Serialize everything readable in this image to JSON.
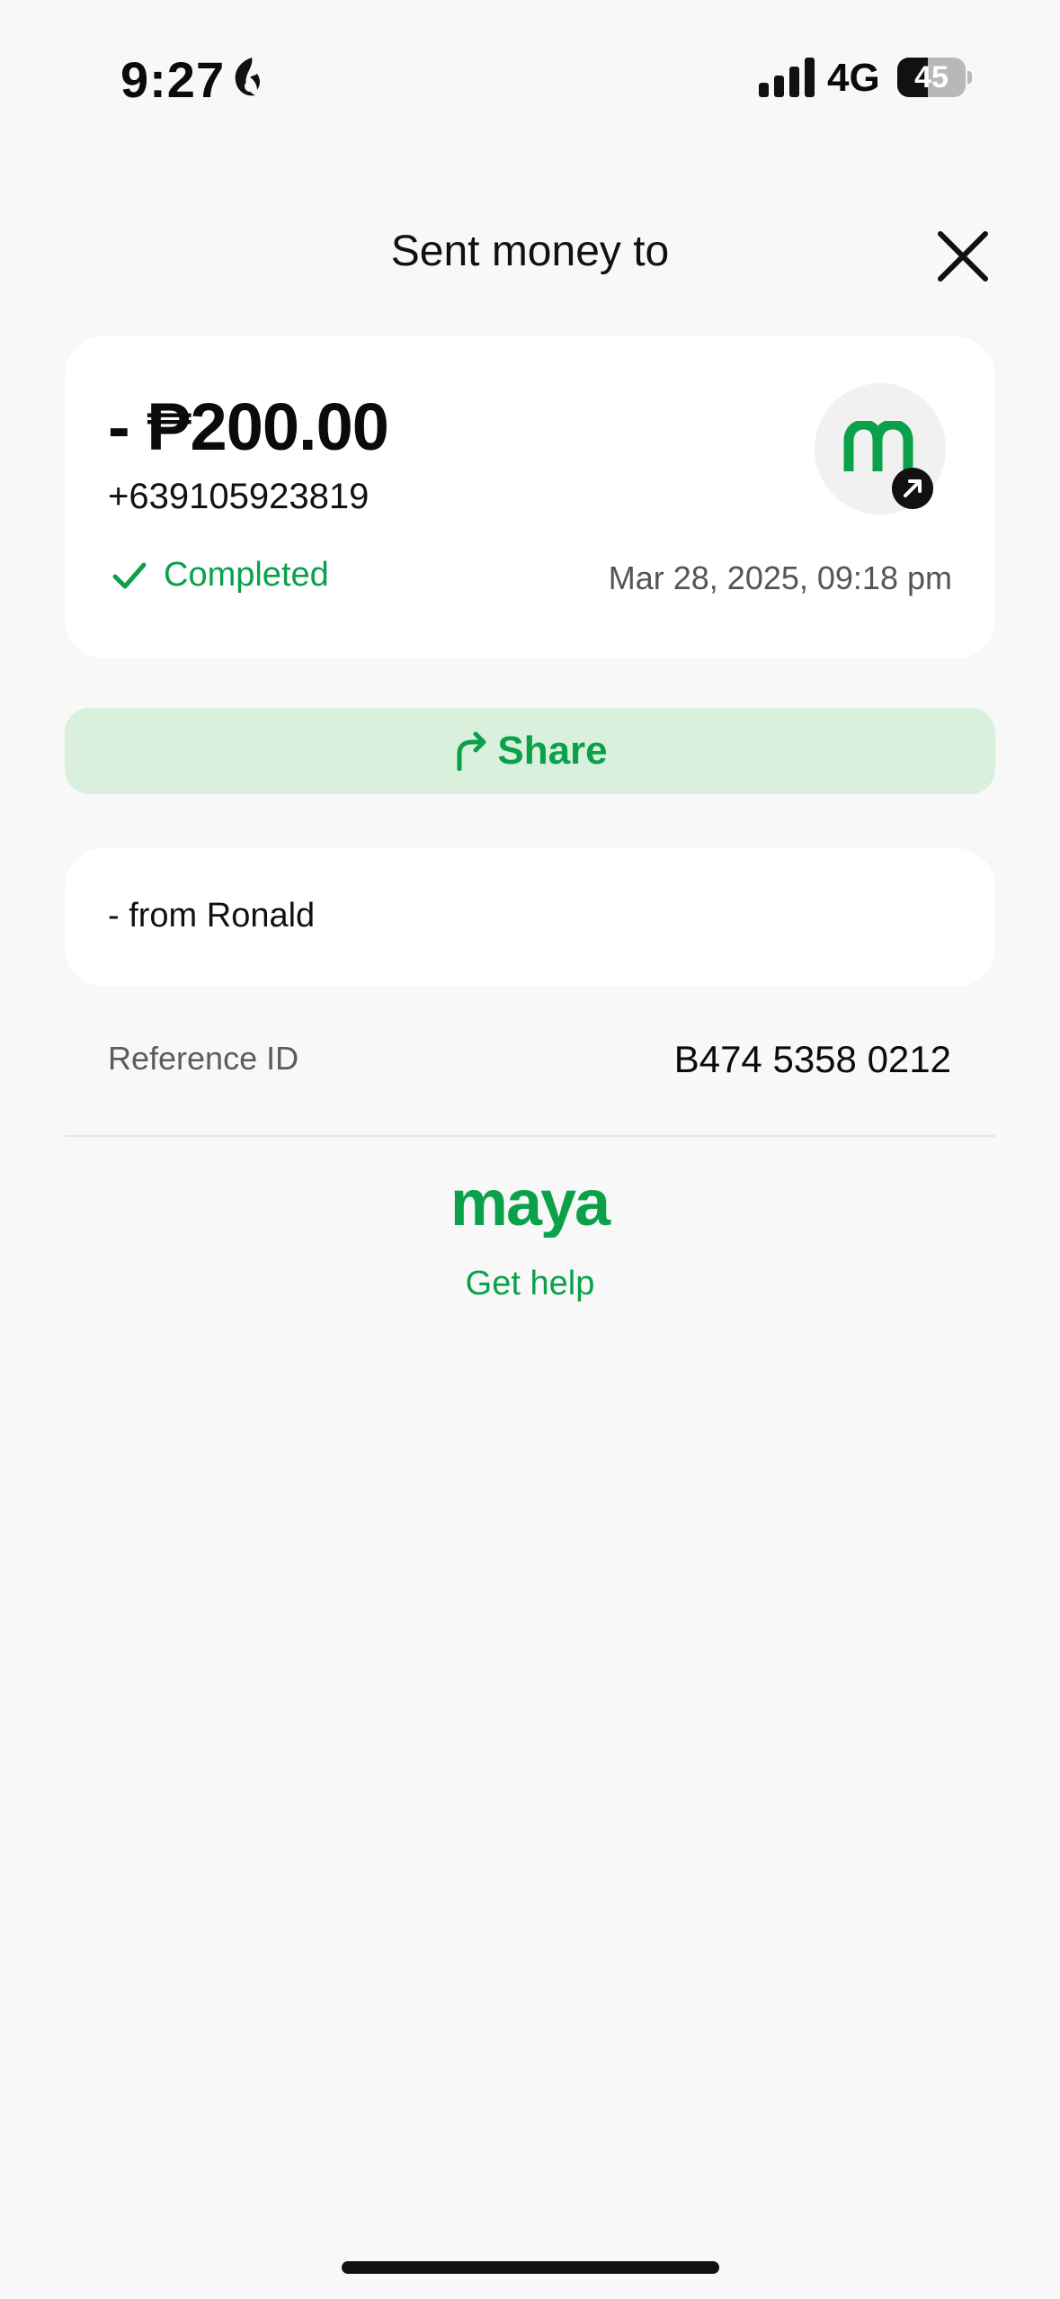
{
  "status_bar": {
    "time": "9:27",
    "network": "4G",
    "battery_level": "45",
    "battery_fraction": 0.45,
    "icons": [
      "focus-moon-icon",
      "signal-icon",
      "battery-icon"
    ]
  },
  "header": {
    "title": "Sent money to",
    "close_icon": "close-icon"
  },
  "transaction": {
    "amount": "- ₱200.00",
    "recipient": "+639105923819",
    "status": "Completed",
    "timestamp": "Mar 28, 2025, 09:18 pm",
    "avatar_icon": "maya-m-icon",
    "badge_icon": "arrow-up-right-icon"
  },
  "share": {
    "label": "Share",
    "icon": "share-arrow-icon"
  },
  "note": {
    "text": "- from Ronald"
  },
  "reference": {
    "label": "Reference ID",
    "value": "B474 5358 0212"
  },
  "footer": {
    "brand": "maya",
    "help_label": "Get help"
  },
  "colors": {
    "brand_green": "#0aa14a",
    "share_bg": "#d9f0dc",
    "page_bg": "#f8f8f8",
    "card_bg": "#ffffff"
  }
}
